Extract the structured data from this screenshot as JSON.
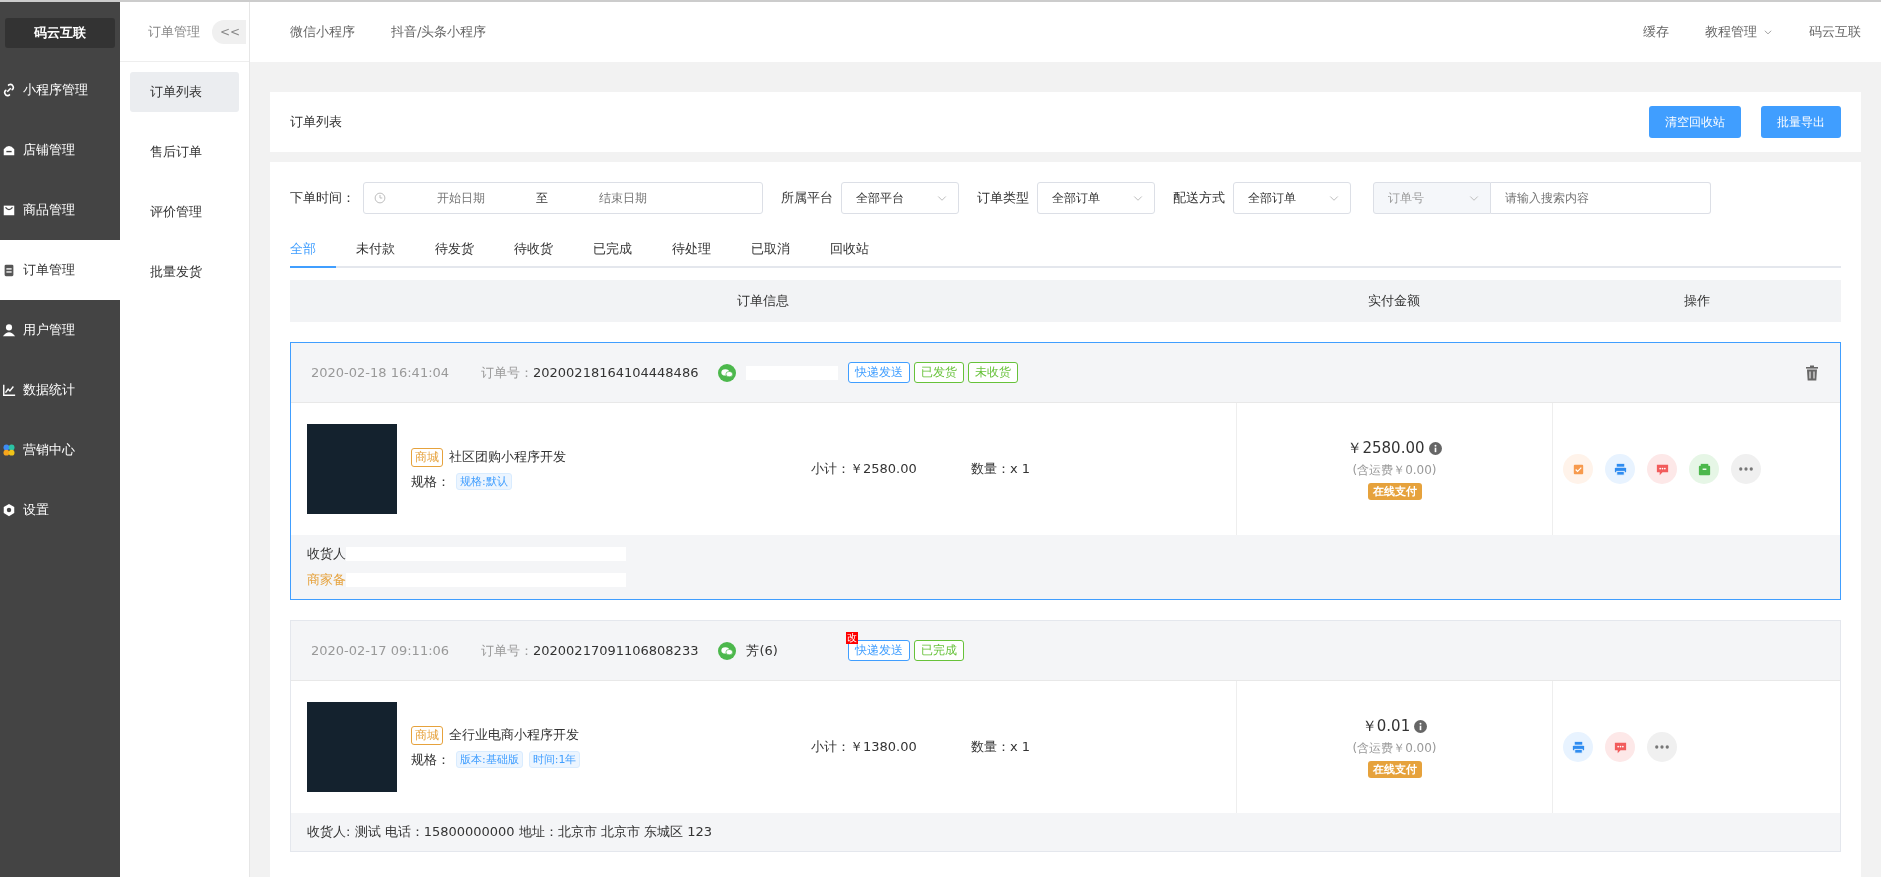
{
  "sidebar": {
    "logo": "码云互联",
    "items": [
      {
        "label": "小程序管理",
        "kind": "link",
        "selected": false
      },
      {
        "label": "店铺管理",
        "kind": "shop",
        "selected": false
      },
      {
        "label": "商品管理",
        "kind": "bag",
        "selected": false
      },
      {
        "label": "订单管理",
        "kind": "clipboard",
        "selected": true
      },
      {
        "label": "用户管理",
        "kind": "user",
        "selected": false
      },
      {
        "label": "数据统计",
        "kind": "chart",
        "selected": false
      },
      {
        "label": "营销中心",
        "kind": "clover",
        "selected": false
      },
      {
        "label": "设置",
        "kind": "gear",
        "selected": false
      }
    ]
  },
  "submenu": {
    "title": "订单管理",
    "collapse": "<<",
    "items": [
      {
        "label": "订单列表",
        "selected": true
      },
      {
        "label": "售后订单",
        "selected": false
      },
      {
        "label": "评价管理",
        "selected": false
      },
      {
        "label": "批量发货",
        "selected": false
      }
    ]
  },
  "topbar": {
    "links": [
      "微信小程序",
      "抖音/头条小程序"
    ],
    "right": [
      {
        "label": "缓存",
        "dropdown": false
      },
      {
        "label": "教程管理",
        "dropdown": true
      },
      {
        "label": "码云互联",
        "dropdown": false
      }
    ]
  },
  "page_header": {
    "title": "订单列表",
    "buttons": [
      "清空回收站",
      "批量导出"
    ]
  },
  "filters": {
    "date_label": "下单时间：",
    "start_placeholder": "开始日期",
    "separator": "至",
    "end_placeholder": "结束日期",
    "selects": [
      {
        "label": "所属平台",
        "value": "全部平台"
      },
      {
        "label": "订单类型",
        "value": "全部订单"
      },
      {
        "label": "配送方式",
        "value": "全部订单"
      }
    ],
    "search_type": "订单号",
    "search_placeholder": "请输入搜索内容"
  },
  "tabs": [
    {
      "label": "全部",
      "selected": true
    },
    {
      "label": "未付款",
      "selected": false
    },
    {
      "label": "待发货",
      "selected": false
    },
    {
      "label": "待收货",
      "selected": false
    },
    {
      "label": "已完成",
      "selected": false
    },
    {
      "label": "待处理",
      "selected": false
    },
    {
      "label": "已取消",
      "selected": false
    },
    {
      "label": "回收站",
      "selected": false
    }
  ],
  "table": {
    "columns": [
      "订单信息",
      "实付金额",
      "操作"
    ]
  },
  "orders": [
    {
      "selected": true,
      "time": "2020-02-18 16:41:04",
      "order_no_label": "订单号：",
      "order_no": "20200218164104448486",
      "tags": [
        {
          "label": "快递发送",
          "color": "#409eff"
        },
        {
          "label": "已发货",
          "color": "#67c23a"
        },
        {
          "label": "未收货",
          "color": "#67c23a"
        }
      ],
      "deletable": true,
      "product": {
        "badge": "商城",
        "name": "社区团购小程序开发",
        "spec_label": "规格：",
        "specs": [
          "规格:默认"
        ],
        "subtotal": "小计：￥2580.00",
        "quantity": "数量：x 1"
      },
      "amount": "￥2580.00",
      "shipping": "(含运费￥0.00)",
      "pay_type": "在线支付",
      "actions": [
        {
          "kind": "receipt"
        },
        {
          "kind": "print"
        },
        {
          "kind": "message"
        },
        {
          "kind": "box"
        },
        {
          "kind": "more"
        }
      ],
      "footer": [
        {
          "kind": "receiver",
          "text": "收货人"
        },
        {
          "kind": "remark",
          "text": "商家备"
        }
      ]
    },
    {
      "selected": false,
      "time": "2020-02-17 09:11:06",
      "order_no_label": "订单号：",
      "order_no": "20200217091106808233",
      "buyer": "芳(6)",
      "modified_flag": "改",
      "tags": [
        {
          "label": "快递发送",
          "color": "#409eff"
        },
        {
          "label": "已完成",
          "color": "#67c23a"
        }
      ],
      "deletable": false,
      "product": {
        "badge": "商城",
        "name": "全行业电商小程序开发",
        "spec_label": "规格：",
        "specs": [
          "版本:基础版",
          "时间:1年"
        ],
        "subtotal": "小计：￥1380.00",
        "quantity": "数量：x 1"
      },
      "amount": "￥0.01",
      "shipping": "(含运费￥0.00)",
      "pay_type": "在线支付",
      "actions": [
        {
          "kind": "print"
        },
        {
          "kind": "message"
        },
        {
          "kind": "more"
        }
      ],
      "footer": [
        {
          "kind": "receiver",
          "text": "收货人: 测试 电话：15800000000 地址：北京市 北京市 东城区 123"
        }
      ]
    }
  ]
}
